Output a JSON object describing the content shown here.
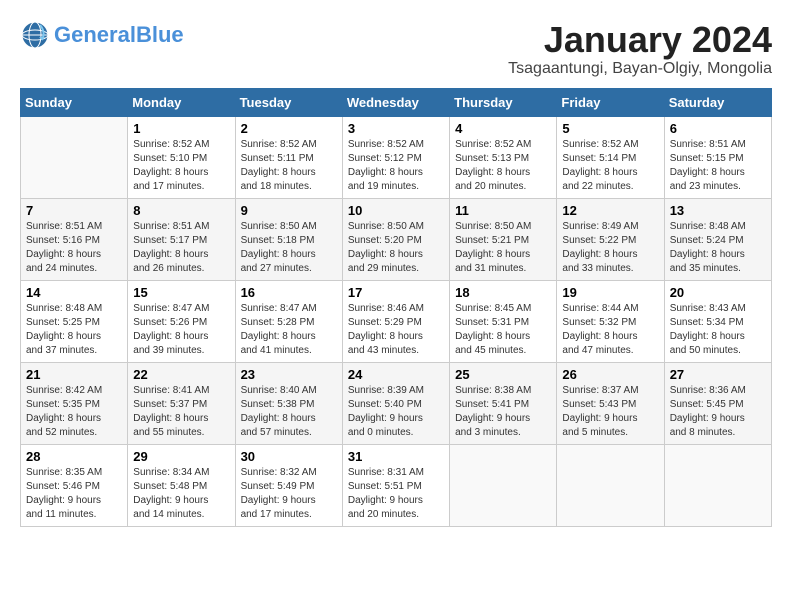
{
  "logo": {
    "brand": "General",
    "color": "Blue",
    "tagline": ""
  },
  "title": "January 2024",
  "subtitle": "Tsagaantungi, Bayan-Olgiy, Mongolia",
  "weekdays": [
    "Sunday",
    "Monday",
    "Tuesday",
    "Wednesday",
    "Thursday",
    "Friday",
    "Saturday"
  ],
  "weeks": [
    [
      {
        "day": "",
        "info": ""
      },
      {
        "day": "1",
        "info": "Sunrise: 8:52 AM\nSunset: 5:10 PM\nDaylight: 8 hours\nand 17 minutes."
      },
      {
        "day": "2",
        "info": "Sunrise: 8:52 AM\nSunset: 5:11 PM\nDaylight: 8 hours\nand 18 minutes."
      },
      {
        "day": "3",
        "info": "Sunrise: 8:52 AM\nSunset: 5:12 PM\nDaylight: 8 hours\nand 19 minutes."
      },
      {
        "day": "4",
        "info": "Sunrise: 8:52 AM\nSunset: 5:13 PM\nDaylight: 8 hours\nand 20 minutes."
      },
      {
        "day": "5",
        "info": "Sunrise: 8:52 AM\nSunset: 5:14 PM\nDaylight: 8 hours\nand 22 minutes."
      },
      {
        "day": "6",
        "info": "Sunrise: 8:51 AM\nSunset: 5:15 PM\nDaylight: 8 hours\nand 23 minutes."
      }
    ],
    [
      {
        "day": "7",
        "info": "Sunrise: 8:51 AM\nSunset: 5:16 PM\nDaylight: 8 hours\nand 24 minutes."
      },
      {
        "day": "8",
        "info": "Sunrise: 8:51 AM\nSunset: 5:17 PM\nDaylight: 8 hours\nand 26 minutes."
      },
      {
        "day": "9",
        "info": "Sunrise: 8:50 AM\nSunset: 5:18 PM\nDaylight: 8 hours\nand 27 minutes."
      },
      {
        "day": "10",
        "info": "Sunrise: 8:50 AM\nSunset: 5:20 PM\nDaylight: 8 hours\nand 29 minutes."
      },
      {
        "day": "11",
        "info": "Sunrise: 8:50 AM\nSunset: 5:21 PM\nDaylight: 8 hours\nand 31 minutes."
      },
      {
        "day": "12",
        "info": "Sunrise: 8:49 AM\nSunset: 5:22 PM\nDaylight: 8 hours\nand 33 minutes."
      },
      {
        "day": "13",
        "info": "Sunrise: 8:48 AM\nSunset: 5:24 PM\nDaylight: 8 hours\nand 35 minutes."
      }
    ],
    [
      {
        "day": "14",
        "info": "Sunrise: 8:48 AM\nSunset: 5:25 PM\nDaylight: 8 hours\nand 37 minutes."
      },
      {
        "day": "15",
        "info": "Sunrise: 8:47 AM\nSunset: 5:26 PM\nDaylight: 8 hours\nand 39 minutes."
      },
      {
        "day": "16",
        "info": "Sunrise: 8:47 AM\nSunset: 5:28 PM\nDaylight: 8 hours\nand 41 minutes."
      },
      {
        "day": "17",
        "info": "Sunrise: 8:46 AM\nSunset: 5:29 PM\nDaylight: 8 hours\nand 43 minutes."
      },
      {
        "day": "18",
        "info": "Sunrise: 8:45 AM\nSunset: 5:31 PM\nDaylight: 8 hours\nand 45 minutes."
      },
      {
        "day": "19",
        "info": "Sunrise: 8:44 AM\nSunset: 5:32 PM\nDaylight: 8 hours\nand 47 minutes."
      },
      {
        "day": "20",
        "info": "Sunrise: 8:43 AM\nSunset: 5:34 PM\nDaylight: 8 hours\nand 50 minutes."
      }
    ],
    [
      {
        "day": "21",
        "info": "Sunrise: 8:42 AM\nSunset: 5:35 PM\nDaylight: 8 hours\nand 52 minutes."
      },
      {
        "day": "22",
        "info": "Sunrise: 8:41 AM\nSunset: 5:37 PM\nDaylight: 8 hours\nand 55 minutes."
      },
      {
        "day": "23",
        "info": "Sunrise: 8:40 AM\nSunset: 5:38 PM\nDaylight: 8 hours\nand 57 minutes."
      },
      {
        "day": "24",
        "info": "Sunrise: 8:39 AM\nSunset: 5:40 PM\nDaylight: 9 hours\nand 0 minutes."
      },
      {
        "day": "25",
        "info": "Sunrise: 8:38 AM\nSunset: 5:41 PM\nDaylight: 9 hours\nand 3 minutes."
      },
      {
        "day": "26",
        "info": "Sunrise: 8:37 AM\nSunset: 5:43 PM\nDaylight: 9 hours\nand 5 minutes."
      },
      {
        "day": "27",
        "info": "Sunrise: 8:36 AM\nSunset: 5:45 PM\nDaylight: 9 hours\nand 8 minutes."
      }
    ],
    [
      {
        "day": "28",
        "info": "Sunrise: 8:35 AM\nSunset: 5:46 PM\nDaylight: 9 hours\nand 11 minutes."
      },
      {
        "day": "29",
        "info": "Sunrise: 8:34 AM\nSunset: 5:48 PM\nDaylight: 9 hours\nand 14 minutes."
      },
      {
        "day": "30",
        "info": "Sunrise: 8:32 AM\nSunset: 5:49 PM\nDaylight: 9 hours\nand 17 minutes."
      },
      {
        "day": "31",
        "info": "Sunrise: 8:31 AM\nSunset: 5:51 PM\nDaylight: 9 hours\nand 20 minutes."
      },
      {
        "day": "",
        "info": ""
      },
      {
        "day": "",
        "info": ""
      },
      {
        "day": "",
        "info": ""
      }
    ]
  ]
}
